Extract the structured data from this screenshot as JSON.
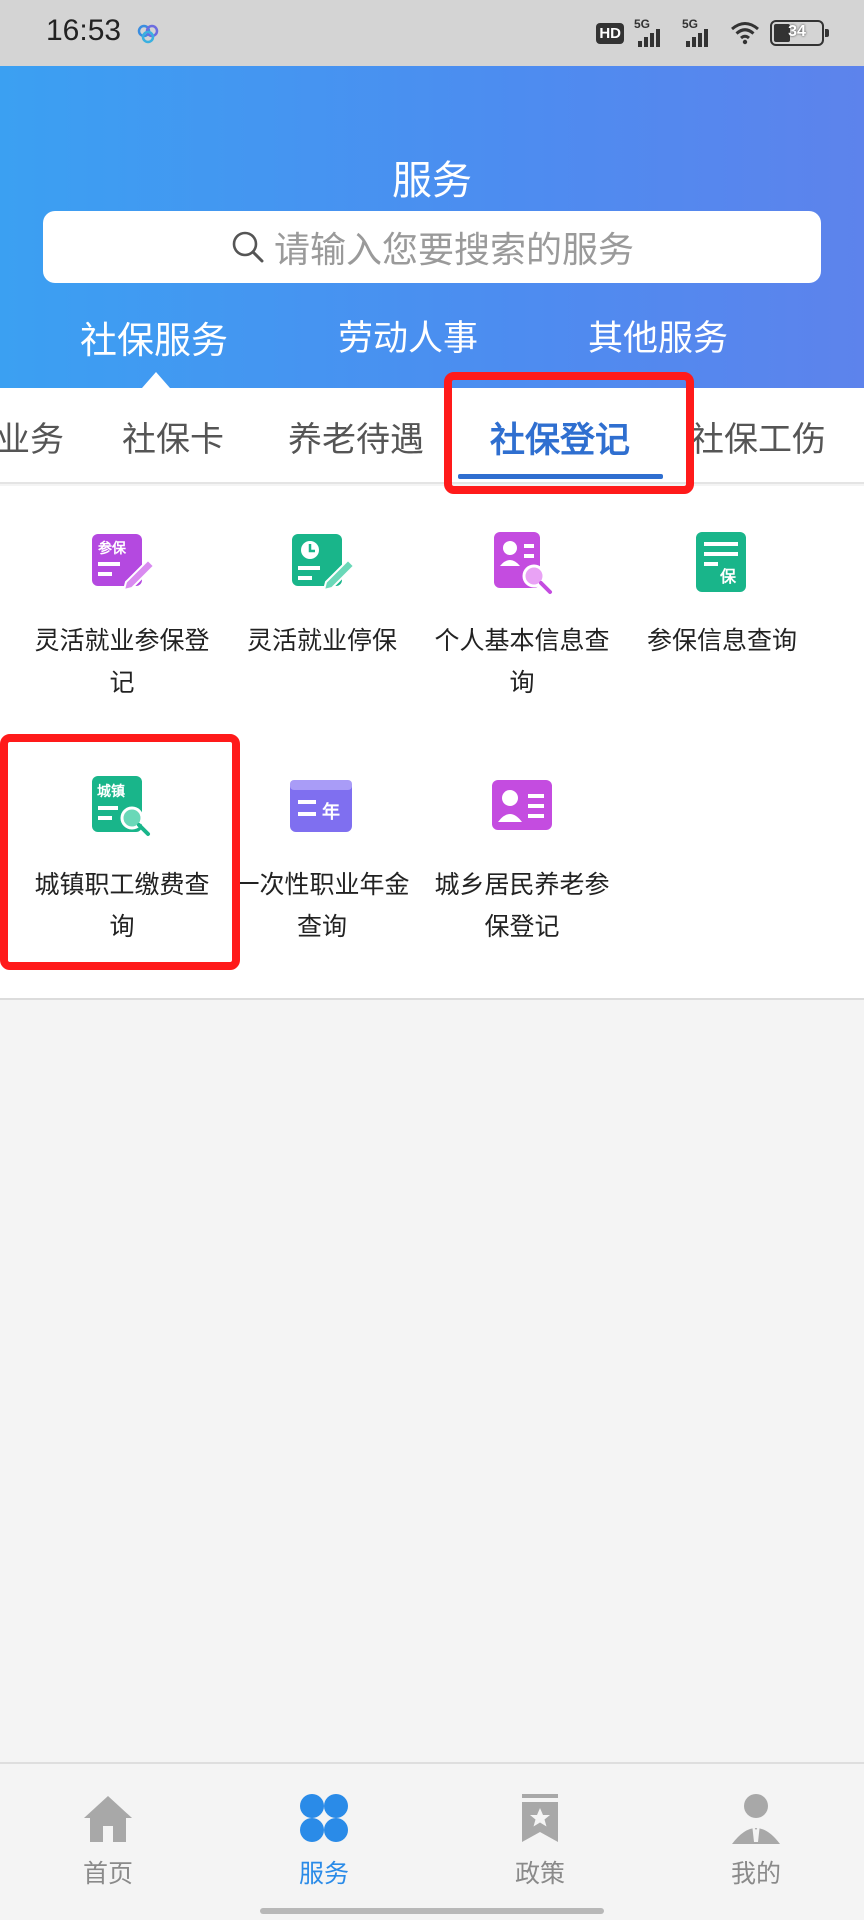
{
  "status_bar": {
    "time": "16:53",
    "hd_label": "HD",
    "signal1_label": "5G",
    "signal2_label": "5G",
    "battery_level": "34",
    "battery_fraction": 0.34
  },
  "header": {
    "title": "服务",
    "search_placeholder": "请输入您要搜索的服务",
    "tabs": [
      "社保服务",
      "劳动人事",
      "其他服务"
    ],
    "active_tab": "社保服务"
  },
  "subtabs": {
    "items": [
      "业务",
      "社保卡",
      "养老待遇",
      "社保登记",
      "社保工伤"
    ],
    "active": "社保登记"
  },
  "grid": {
    "items": [
      {
        "label": "灵活就业参保登记",
        "icon": "badge-edit-icon",
        "color": "#b449e0"
      },
      {
        "label": "灵活就业停保",
        "icon": "stop-edit-icon",
        "color": "#19b58a"
      },
      {
        "label": "个人基本信息查询",
        "icon": "person-search-icon",
        "color": "#c44ce0"
      },
      {
        "label": "参保信息查询",
        "icon": "insurance-doc-icon",
        "color": "#19b58a"
      },
      {
        "label": "城镇职工缴费查询",
        "icon": "city-search-icon",
        "color": "#19b58a"
      },
      {
        "label": "一次性职业年金查询",
        "icon": "year-card-icon",
        "color": "#7f6ff0"
      },
      {
        "label": "城乡居民养老参保登记",
        "icon": "resident-card-icon",
        "color": "#c44ce0"
      }
    ],
    "icon_texts": {
      "badge": "参保",
      "city": "城镇",
      "year": "年",
      "insurance": "保"
    }
  },
  "bottom_nav": {
    "items": [
      {
        "label": "首页",
        "icon": "home-icon"
      },
      {
        "label": "服务",
        "icon": "services-icon"
      },
      {
        "label": "政策",
        "icon": "policy-bookmark-icon"
      },
      {
        "label": "我的",
        "icon": "profile-icon"
      }
    ],
    "active": "服务"
  },
  "colors": {
    "header_gradient_start": "#3ba0f2",
    "header_gradient_end": "#5d83ec",
    "accent": "#2f6fd0",
    "nav_active": "#2a8be8",
    "highlight": "#ff1a1a"
  }
}
